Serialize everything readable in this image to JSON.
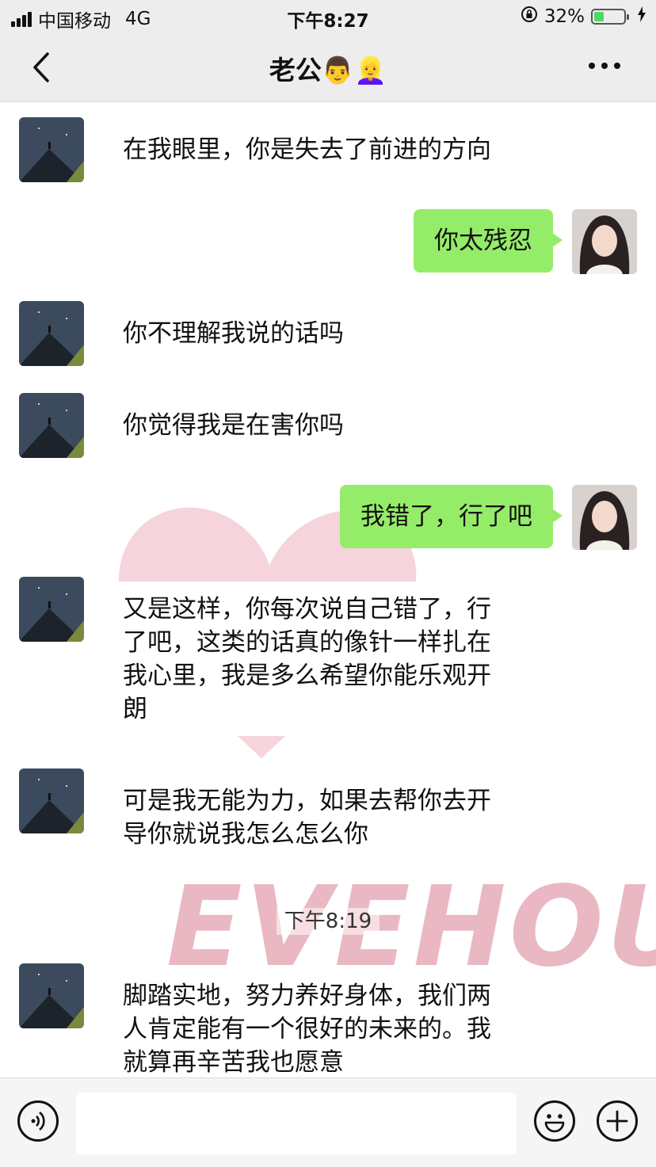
{
  "status_bar": {
    "carrier": "中国移动",
    "network": "4G",
    "time": "下午8:27",
    "battery": "32%",
    "battery_level": 0.32
  },
  "nav": {
    "title": "老公👨👱‍♀️"
  },
  "messages": [
    {
      "from": "other",
      "text": "在我眼里，你是失去了前进的方向"
    },
    {
      "from": "me",
      "text": "你太残忍"
    },
    {
      "from": "other",
      "text": "你不理解我说的话吗"
    },
    {
      "from": "other",
      "text": "你觉得我是在害你吗"
    },
    {
      "from": "me",
      "text": "我错了，行了吧"
    },
    {
      "from": "other",
      "lines": [
        "又是这样，你每次说自己错了，行",
        "了吧，这类的话真的像针一样扎在",
        "我心里，我是多么希望你能乐观开",
        "朗"
      ]
    },
    {
      "from": "other",
      "lines": [
        "可是我无能为力，如果去帮你去开",
        "导你就说我怎么怎么你"
      ]
    },
    {
      "from": "other",
      "lines": [
        "脚踏实地，努力养好身体，我们两",
        "人肯定能有一个很好的未来的。我",
        "就算再辛苦我也愿意"
      ]
    }
  ],
  "timestamp": "下午8:19",
  "watermark": "EVEHOU",
  "colors": {
    "bubble_me": "#95ec69",
    "nav_bg": "#ededed",
    "watermark": "#e9b8c2"
  },
  "icons": {
    "back": "chevron-left-icon",
    "more": "more-dots-icon",
    "voice": "voice-icon",
    "emoji": "emoji-icon",
    "plus": "plus-icon"
  }
}
